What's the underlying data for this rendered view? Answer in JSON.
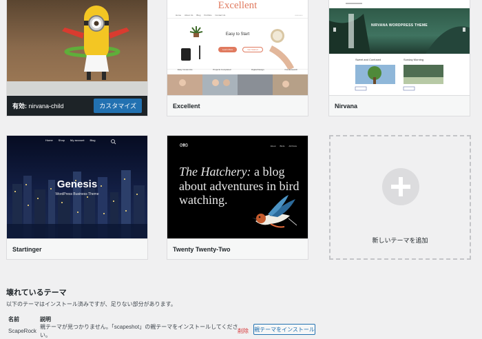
{
  "themes": {
    "active": {
      "prefix": "有効:",
      "name": "nirvana-child",
      "customize_label": "カスタマイズ"
    },
    "excellent": {
      "name": "Excellent",
      "preview": {
        "logo": "Excellent",
        "tagline": "Easy to Start",
        "nav": [
          "Home",
          "About Us",
          "Blog",
          "Portfolio",
          "Contact Us"
        ],
        "buttons": [
          "Learn More",
          "Get Started"
        ],
        "features": [
          "Easy Customize",
          "Projects Completed",
          "Digital Design",
          "Our Research"
        ]
      }
    },
    "nirvana": {
      "name": "Nirvana",
      "preview": {
        "banner": "NIRVANA WORDPRESS THEME",
        "posts": [
          "Sweet and Confused",
          "Sunday Morning"
        ]
      }
    },
    "startinger": {
      "name": "Startinger",
      "preview": {
        "nav": [
          "Home",
          "Shop",
          "My account",
          "Blog"
        ],
        "headline": "Genesis",
        "subline": "WordPress Business Theme"
      }
    },
    "twentytwo": {
      "name": "Twenty Twenty-Two",
      "preview": {
        "logo": "ᘛᘚ",
        "nav": [
          "About",
          "Birds",
          "All Posts"
        ],
        "headline_italic": "The Hatchery:",
        "headline_rest": " a blog about adventures in bird watching."
      }
    },
    "add_new": {
      "label": "新しいテーマを追加"
    }
  },
  "broken": {
    "title": "壊れているテーマ",
    "description": "以下のテーマはインストール済みですが、足りない部分があります。",
    "headers": {
      "name": "名前",
      "description": "説明"
    },
    "rows": [
      {
        "name": "ScapeRock",
        "desc_line1": "親テーマが見つかりません。「scapeshot」の親テーマをインストールしてくださ",
        "desc_line2": "い。",
        "delete": "削除",
        "install": "親テーマをインストール"
      }
    ]
  },
  "colors": {
    "accent": "#2271b1",
    "danger": "#d63638",
    "admin_dark": "#1d2327",
    "background": "#f0f0f1"
  }
}
